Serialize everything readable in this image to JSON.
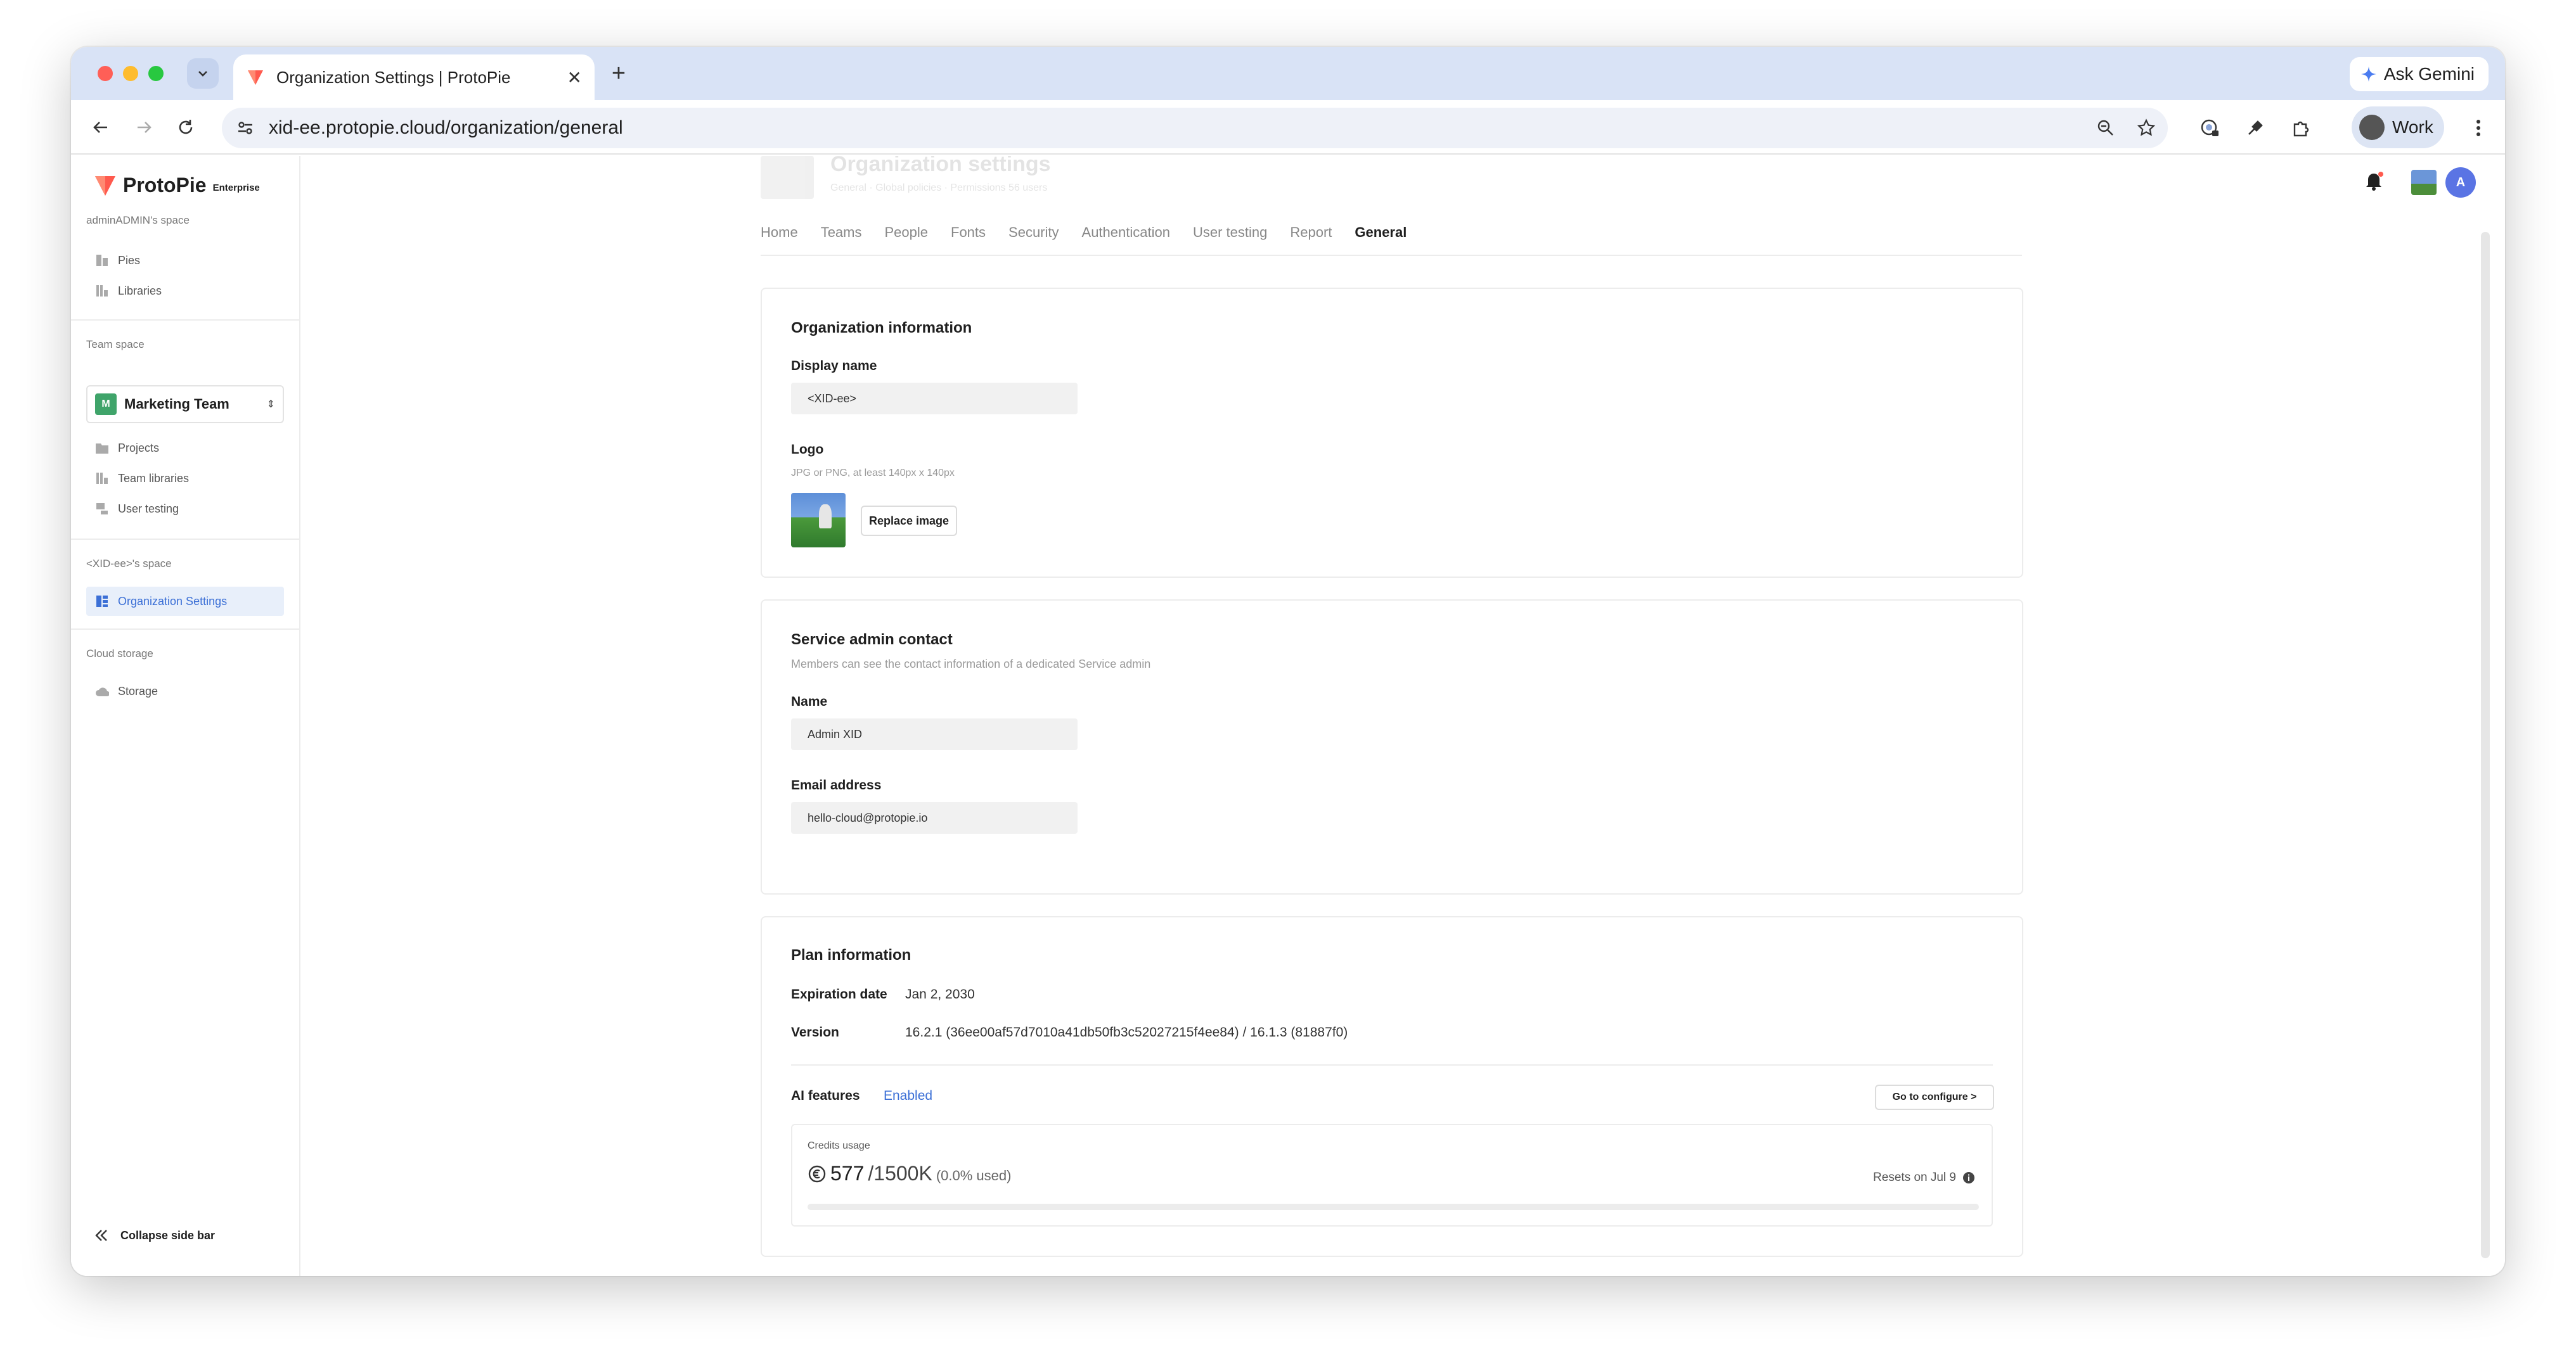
{
  "browser": {
    "tab_title": "Organization Settings | ProtoPie",
    "new_tab": "+",
    "gemini_label": "Ask Gemini",
    "url": "xid-ee.protopie.cloud/organization/general",
    "profile_label": "Work"
  },
  "sidebar": {
    "brand": "ProtoPie",
    "brand_tier": "Enterprise",
    "personal_space_title": "adminADMIN's space",
    "personal_items": [
      {
        "label": "Pies",
        "icon": "pies-icon"
      },
      {
        "label": "Libraries",
        "icon": "libraries-icon"
      }
    ],
    "team_space_title": "Team space",
    "team_select": {
      "badge": "M",
      "label": "Marketing Team"
    },
    "team_items": [
      {
        "label": "Projects",
        "icon": "folder-icon"
      },
      {
        "label": "Team libraries",
        "icon": "libraries-icon"
      },
      {
        "label": "User testing",
        "icon": "user-testing-icon"
      }
    ],
    "org_space_title": "<XID-ee>'s space",
    "org_items": [
      {
        "label": "Organization Settings",
        "icon": "org-settings-icon",
        "active": true
      }
    ],
    "cloud_title": "Cloud storage",
    "cloud_items": [
      {
        "label": "Storage",
        "icon": "cloud-icon"
      }
    ],
    "collapse_label": "Collapse side bar"
  },
  "header": {
    "faded_title": "Organization settings",
    "faded_subtitle": "General · Global policies · Permissions 56 users",
    "avatar_initial": "A"
  },
  "tabs": [
    "Home",
    "Teams",
    "People",
    "Fonts",
    "Security",
    "Authentication",
    "User testing",
    "Report",
    "General"
  ],
  "active_tab": "General",
  "org_info": {
    "title": "Organization information",
    "display_name_label": "Display name",
    "display_name_value": "<XID-ee>",
    "logo_label": "Logo",
    "logo_hint": "JPG or PNG, at least 140px x 140px",
    "replace_button": "Replace image"
  },
  "admin_contact": {
    "title": "Service admin contact",
    "description": "Members can see the contact information of a dedicated Service admin",
    "name_label": "Name",
    "name_value": "Admin XID",
    "email_label": "Email address",
    "email_value": "hello-cloud@protopie.io"
  },
  "plan": {
    "title": "Plan information",
    "expiration_label": "Expiration date",
    "expiration_value": "Jan 2, 2030",
    "version_label": "Version",
    "version_value": "16.2.1 (36ee00af57d7010a41db50fb3c52027215f4ee84) / 16.1.3 (81887f0)",
    "ai_label": "AI features",
    "ai_status": "Enabled",
    "configure_button": "Go to configure >",
    "credits_label": "Credits usage",
    "credits_used": "577",
    "credits_total": "/1500K",
    "credits_percent": "(0.0% used)",
    "credits_fraction": 0.0,
    "resets": "Resets on Jul 9"
  },
  "colors": {
    "accent": "#3b6fd6",
    "brand": "#ff5a4e",
    "tabbar": "#d9e3f6"
  }
}
